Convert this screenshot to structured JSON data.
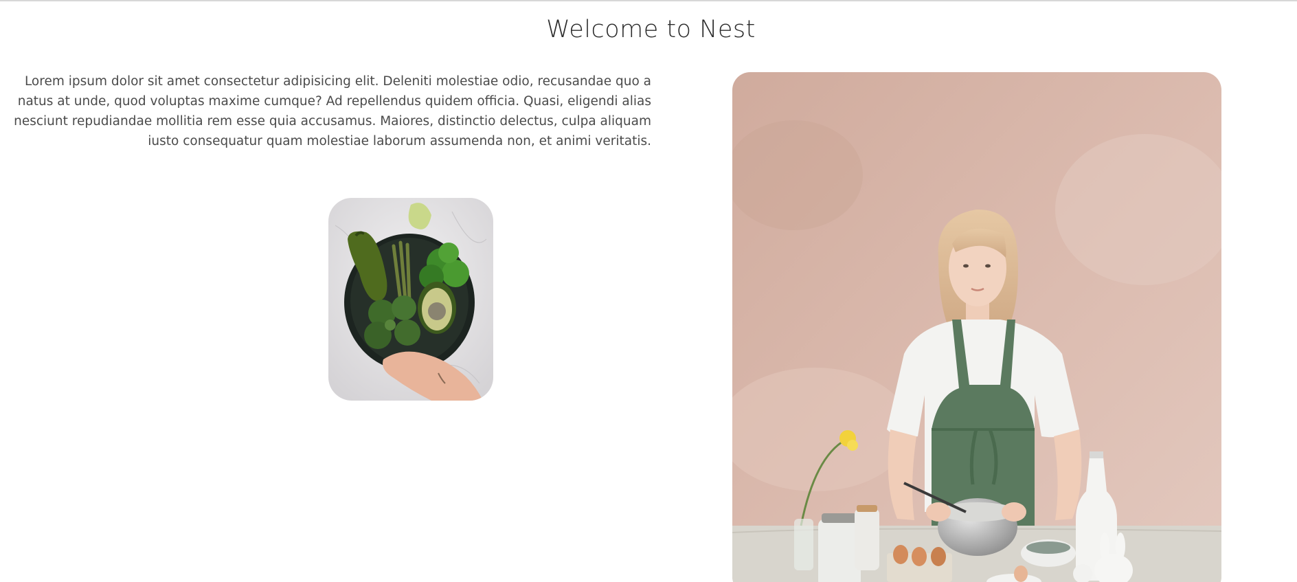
{
  "page": {
    "title": "Welcome to Nest",
    "intro_text": "Lorem ipsum dolor sit amet consectetur adipisicing elit. Deleniti molestiae odio, recusandae quo a natus at unde, quod voluptas maxime cumque? Ad repellendus quidem officia. Quasi, eligendi alias nesciunt repudiandae mollitia rem esse quia accusamus. Maiores, distinctio delectus, culpa aliquam iusto consequatur quam molestiae laborum assumenda non, et animi veritatis."
  },
  "colors": {
    "title_text": "#2a2a2a",
    "body_text": "#4a4a4a",
    "wall_pink": "#d9b8ad",
    "apron_green": "#5b7a5f",
    "background": "#ffffff"
  }
}
